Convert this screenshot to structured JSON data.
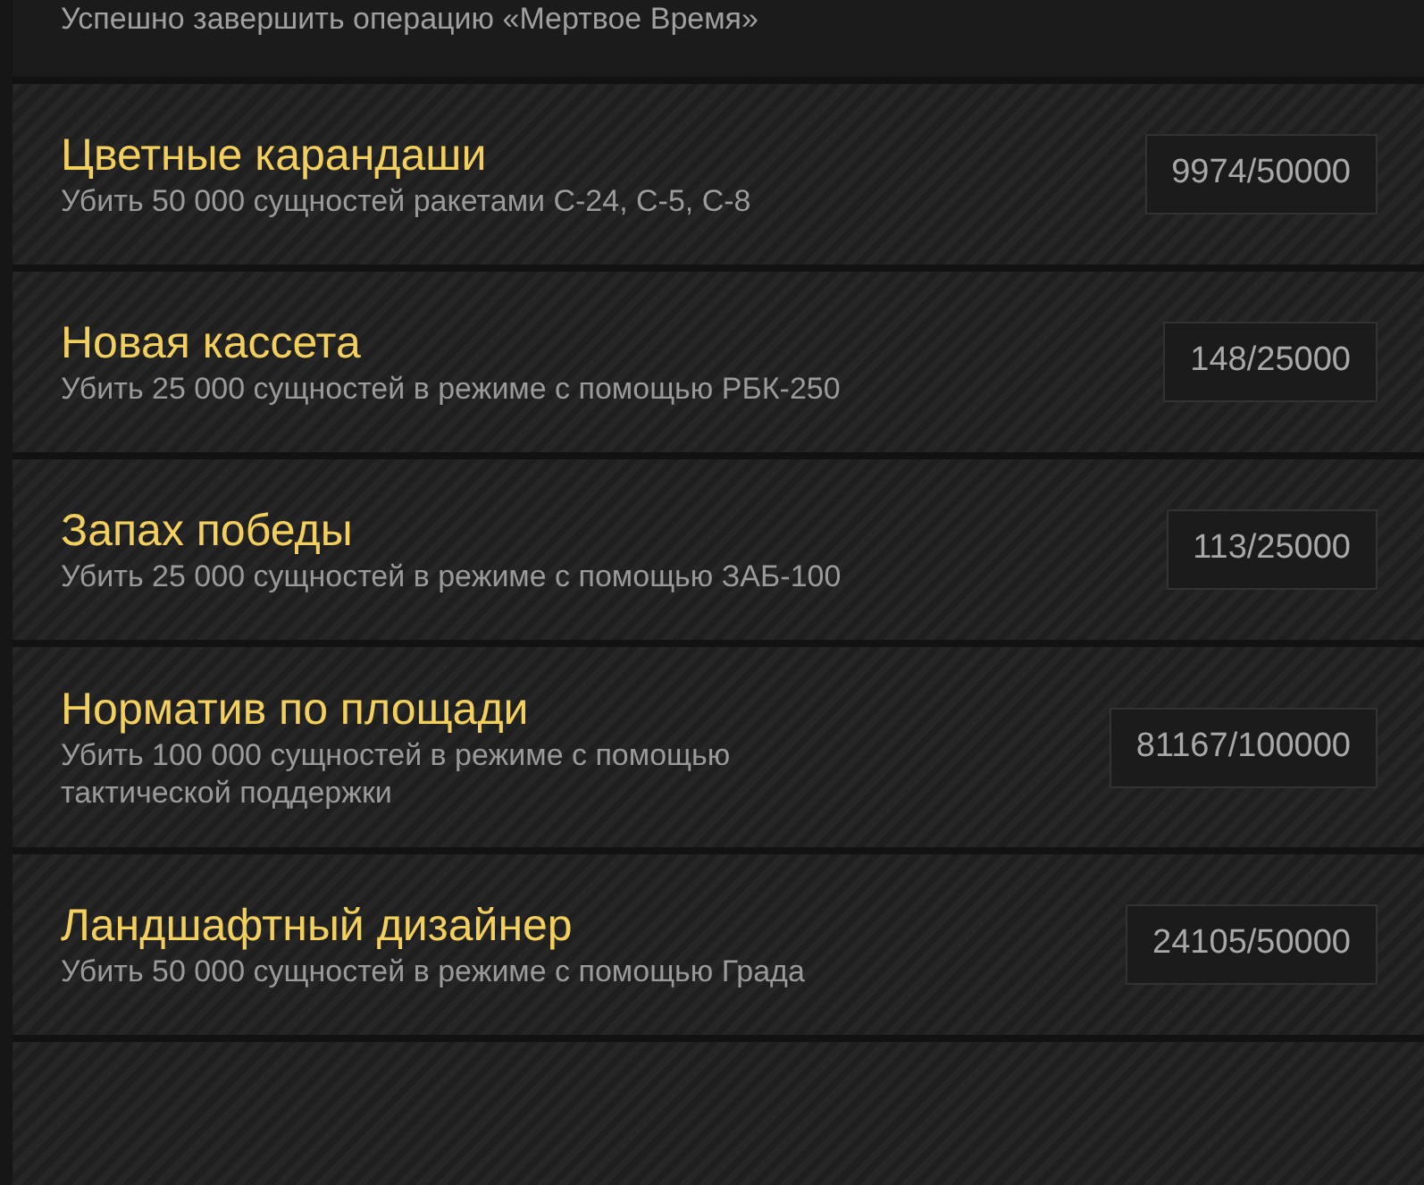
{
  "top_card": {
    "description": "Успешно завершить операцию «Мертвое Время»"
  },
  "achievements": [
    {
      "title": "Цветные карандаши",
      "description": "Убить 50 000 сущностей ракетами С-24, С-5, С-8",
      "progress": "9974/50000"
    },
    {
      "title": "Новая кассета",
      "description": "Убить 25 000 сущностей в режиме с помощью РБК-250",
      "progress": "148/25000"
    },
    {
      "title": "Запах победы",
      "description": "Убить 25 000 сущностей в режиме с помощью ЗАБ-100",
      "progress": "113/25000"
    },
    {
      "title": "Норматив по площади",
      "description": "Убить 100 000 сущностей в режиме с помощью тактической поддержки",
      "progress": "81167/100000"
    },
    {
      "title": "Ландшафтный дизайнер",
      "description": "Убить 50 000 сущностей в режиме с помощью Града",
      "progress": "24105/50000"
    }
  ]
}
